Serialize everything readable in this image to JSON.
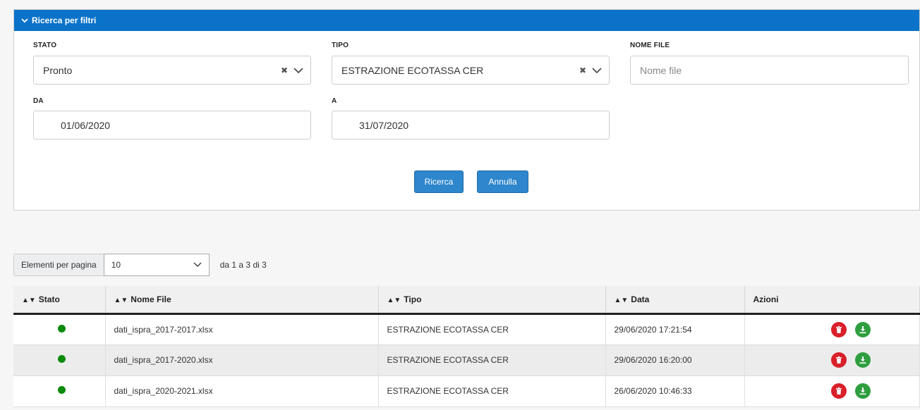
{
  "filters": {
    "header_title": "Ricerca per filtri",
    "stato": {
      "label": "STATO",
      "value": "Pronto"
    },
    "tipo": {
      "label": "TIPO",
      "value": "ESTRAZIONE ECOTASSA CER"
    },
    "nome_file": {
      "label": "NOME FILE",
      "placeholder": "Nome file"
    },
    "da": {
      "label": "DA",
      "value": "01/06/2020"
    },
    "a": {
      "label": "A",
      "value": "31/07/2020"
    },
    "search_button": "Ricerca",
    "cancel_button": "Annulla"
  },
  "pagination": {
    "label": "Elementi per pagina",
    "page_size": "10",
    "info": "da 1 a 3 di 3"
  },
  "table": {
    "columns": [
      "Stato",
      "Nome File",
      "Tipo",
      "Data",
      "Azioni"
    ],
    "rows": [
      {
        "stato_color": "#0b8a0b",
        "nome_file": "dati_ispra_2017-2017.xlsx",
        "tipo": "ESTRAZIONE ECOTASSA CER",
        "data": "29/06/2020 17:21:54"
      },
      {
        "stato_color": "#0b8a0b",
        "nome_file": "dati_ispra_2017-2020.xlsx",
        "tipo": "ESTRAZIONE ECOTASSA CER",
        "data": "29/06/2020 16:20:00"
      },
      {
        "stato_color": "#0b8a0b",
        "nome_file": "dati_ispra_2020-2021.xlsx",
        "tipo": "ESTRAZIONE ECOTASSA CER",
        "data": "26/06/2020 10:46:33"
      }
    ]
  },
  "colors": {
    "header_blue": "#0a73c9",
    "button_blue": "#2e86cc",
    "delete_red": "#d9202a",
    "download_green": "#2e9e3e"
  },
  "icons": {
    "header": "chevron-down-icon",
    "clear": "clear-icon",
    "dropdown": "chevron-down-icon",
    "sort": "sort-icon",
    "delete": "trash-icon",
    "download": "download-icon"
  }
}
